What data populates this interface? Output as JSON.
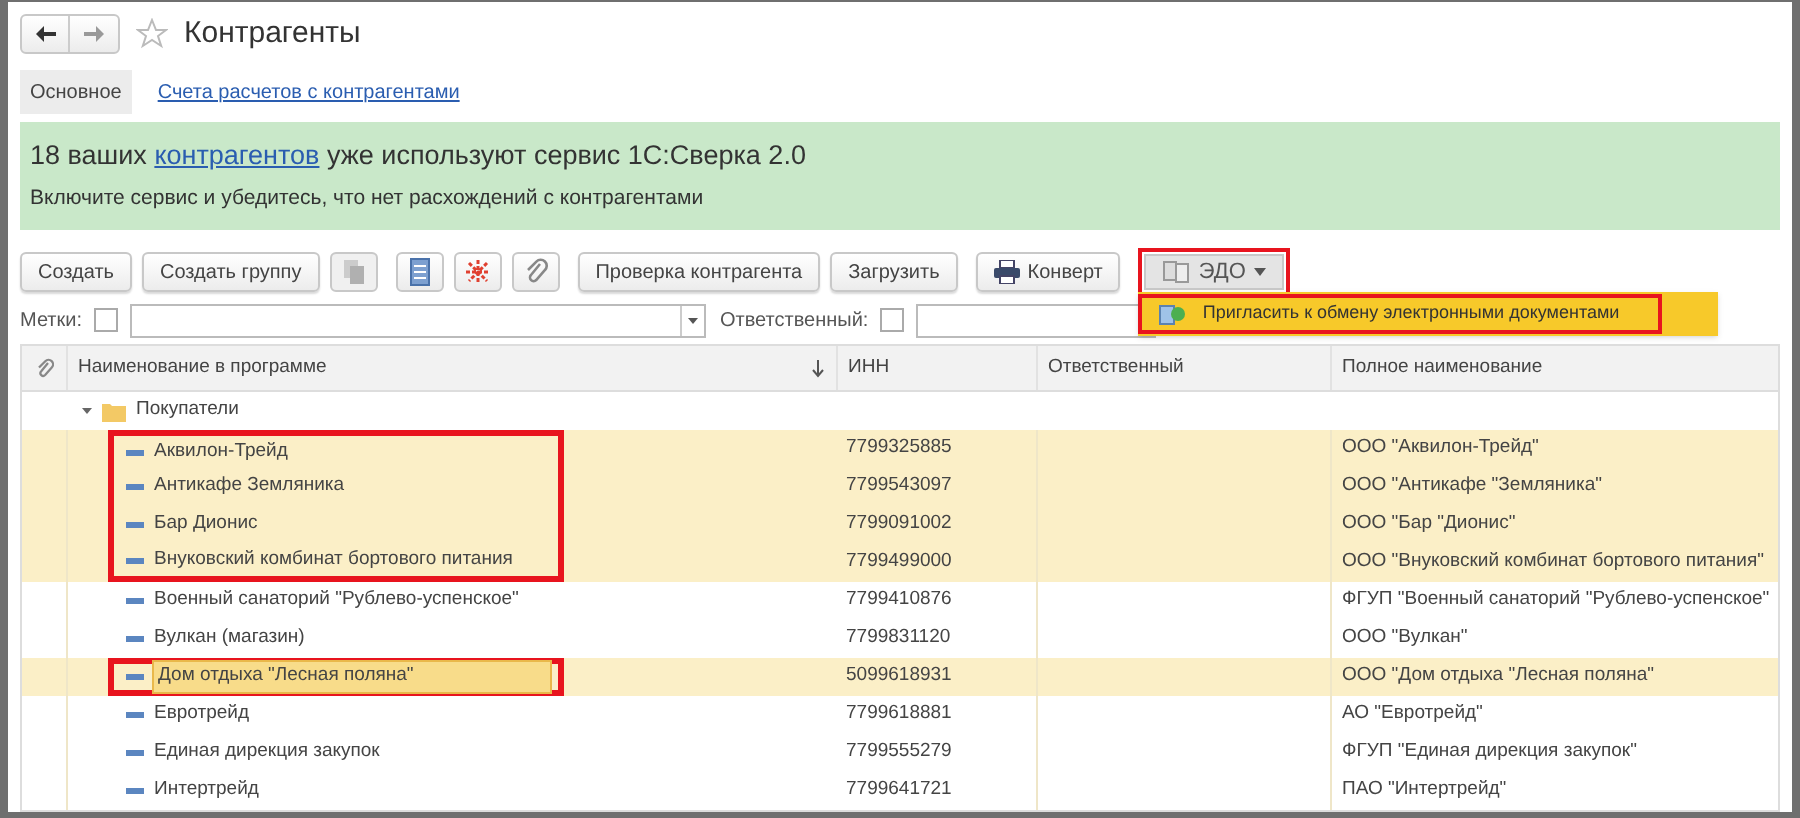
{
  "window": {
    "title": "Контрагенты",
    "favorite": false
  },
  "tabs": [
    {
      "label": "Основное",
      "selected": true
    },
    {
      "label": "Счета расчетов с контрагентами",
      "selected": false
    }
  ],
  "banner": {
    "headline_before": "18 ваших",
    "headline_link": "контрагентов",
    "headline_after": "уже используют сервис 1С:Сверка 2.0",
    "text": "Включите сервис и убедитесь, что нет расхождений с контрагентами"
  },
  "toolbar": [
    {
      "kind": "text",
      "label": "Создать"
    },
    {
      "kind": "text",
      "label": "Создать группу"
    },
    {
      "kind": "icon",
      "disabled": true
    },
    {
      "kind": "icon",
      "disabled": false
    },
    {
      "kind": "icon",
      "disabled": false
    },
    {
      "kind": "icon",
      "disabled": false
    },
    {
      "kind": "text",
      "label": "Проверка контрагента"
    },
    {
      "kind": "text",
      "label": "Загрузить"
    },
    {
      "kind": "print",
      "label": "Конверт"
    },
    {
      "kind": "menu",
      "label": "ЭДО",
      "marked": true,
      "expanded": true,
      "menu": [
        {
          "label": "Пригласить к обмену электронными документами",
          "marked": true
        }
      ]
    }
  ],
  "filters": {
    "tags_label": "Метки:",
    "tags_checked": false,
    "responsible_label": "Ответственный:",
    "responsible_checked": false
  },
  "table": {
    "columns": [
      "Наименование в программе",
      "ИНН",
      "Ответственный",
      "Полное наименование"
    ],
    "groups": [
      {
        "name": "Покупатели",
        "expanded": true,
        "children": [
          {
            "name": "Аквилон-Трейд",
            "inn": "7799325885",
            "full": "ООО \"Аквилон-Трейд\"",
            "selected": true,
            "focused": false,
            "marked": true
          },
          {
            "name": "Антикафе Земляника",
            "inn": "7799543097",
            "full": "ООО \"Антикафе \"Земляника\"",
            "selected": true,
            "focused": false,
            "marked": true
          },
          {
            "name": "Бар Дионис",
            "inn": "7799091002",
            "full": "ООО \"Бар \"Дионис\"",
            "selected": true,
            "focused": false,
            "marked": true
          },
          {
            "name": "Внуковский комбинат бортового питания",
            "inn": "7799499000",
            "full": "ООО \"Внуковский комбинат бортового питания\"",
            "selected": true,
            "focused": false,
            "marked": true
          },
          {
            "name": "Военный санаторий \"Рублево-успенское\"",
            "inn": "7799410876",
            "full": "ФГУП \"Военный санаторий \"Рублево-успенское\"",
            "selected": false,
            "focused": false,
            "marked": false
          },
          {
            "name": "Вулкан (магазин)",
            "inn": "7799831120",
            "full": "ООО \"Вулкан\"",
            "selected": false,
            "focused": false,
            "marked": false
          },
          {
            "name": "Дом отдыха \"Лесная поляна\"",
            "inn": "5099618931",
            "full": "ООО \"Дом отдыха \"Лесная поляна\"",
            "selected": true,
            "focused": true,
            "marked": true
          },
          {
            "name": "Евротрейд",
            "inn": "7799618881",
            "full": "АО \"Евротрейд\"",
            "selected": false,
            "focused": false,
            "marked": false
          },
          {
            "name": "Единая дирекция закупок",
            "inn": "7799555279",
            "full": "ФГУП \"Единая дирекция закупок\"",
            "selected": false,
            "focused": false,
            "marked": false
          },
          {
            "name": "Интертрейд",
            "inn": "7799641721",
            "full": "ПАО \"Интертрейд\"",
            "selected": false,
            "focused": false,
            "marked": false
          }
        ]
      }
    ]
  }
}
